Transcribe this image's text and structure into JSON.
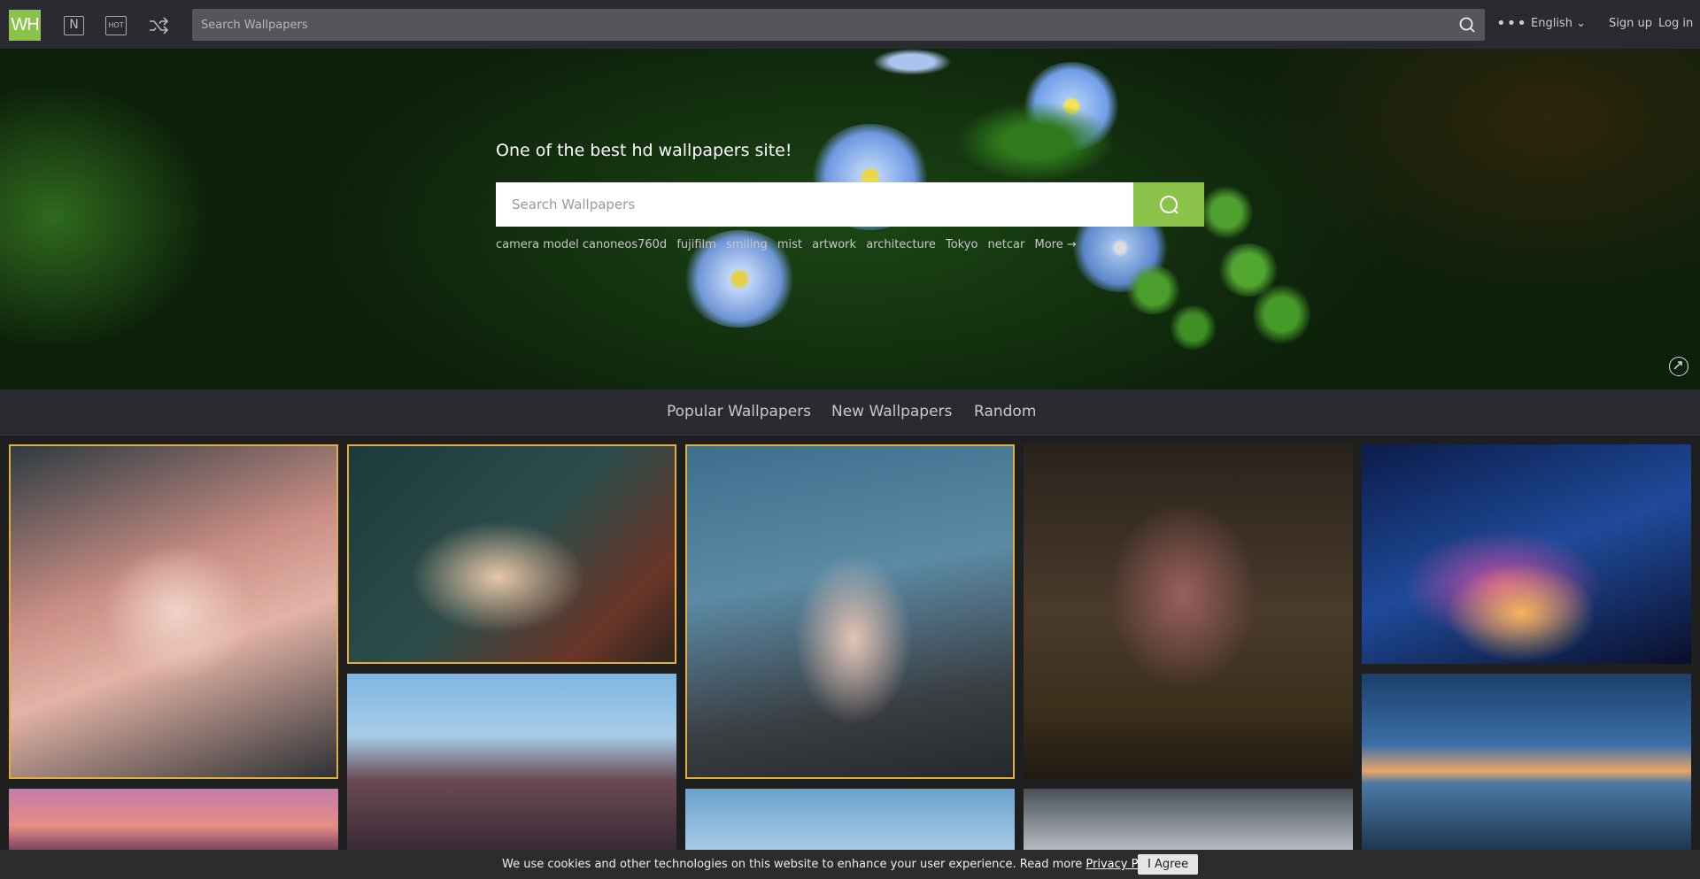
{
  "header": {
    "logo": "WH",
    "new_icon": "N",
    "hot_icon": "HOT",
    "search_placeholder": "Search Wallpapers",
    "more_icon": "•••",
    "language": "English ⌄",
    "signup": "Sign up",
    "login": "Log in"
  },
  "hero": {
    "title": "One of the best hd wallpapers site!",
    "search_placeholder": "Search Wallpapers",
    "tags": [
      "camera model canoneos760d",
      "fujifilm",
      "smiling",
      "mist",
      "artwork",
      "architecture",
      "Tokyo",
      "netcar",
      "More →"
    ]
  },
  "tabs": [
    "Popular Wallpapers",
    "New Wallpapers",
    "Random"
  ],
  "cookie": {
    "message": "We use cookies and other technologies on this website to enhance your user experience. Read more",
    "link": "Privacy Policy",
    "end": ".",
    "button": "I Agree"
  },
  "colors": {
    "accent": "#8bc34a",
    "topbar": "#2a2b30",
    "selected_outline": "#e2b03a"
  },
  "icons": [
    "search-icon",
    "new-icon",
    "hot-icon",
    "shuffle-icon",
    "more-icon",
    "refresh-icon"
  ]
}
